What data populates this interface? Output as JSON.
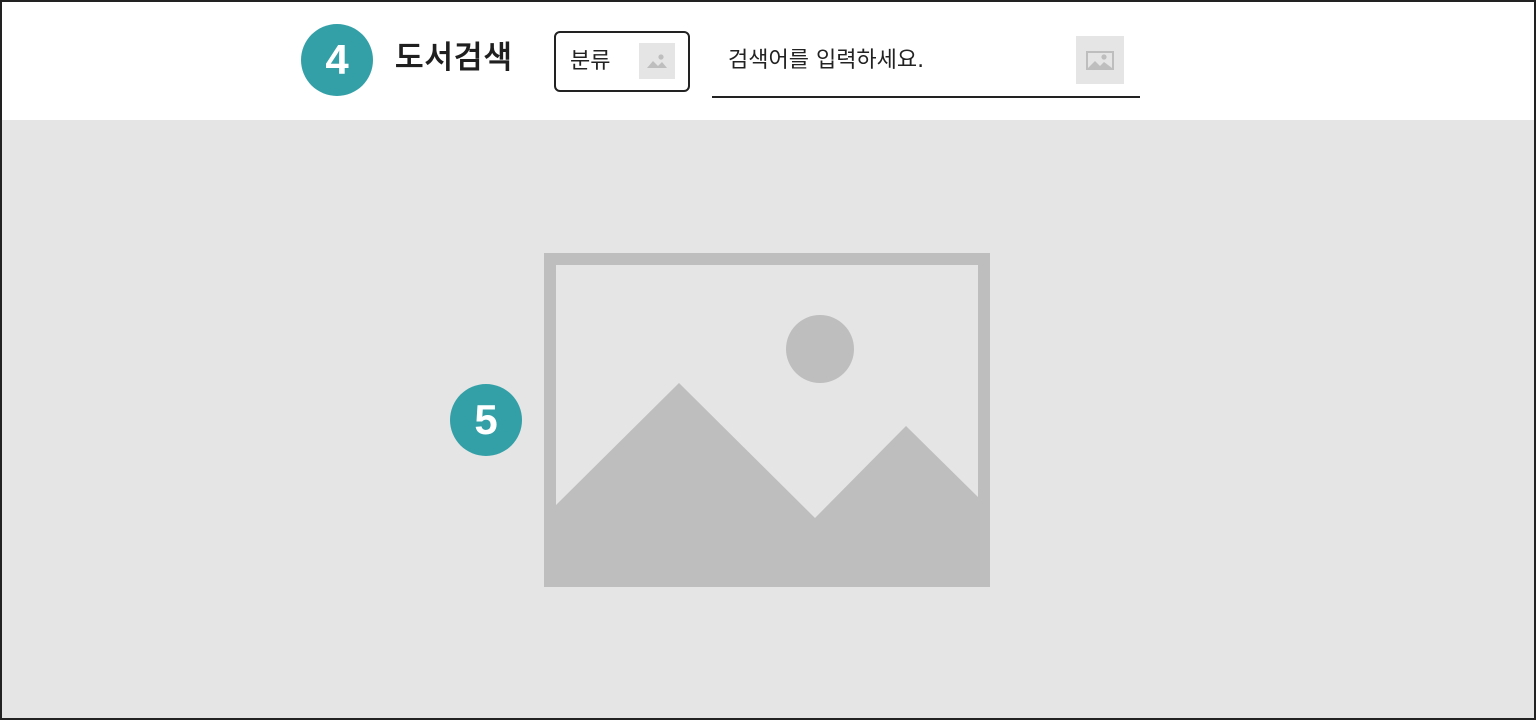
{
  "colors": {
    "accent": "#33a0a8",
    "placeholder_bg": "#e5e5e5",
    "placeholder_fg": "#bebebe",
    "border": "#222222"
  },
  "steps": {
    "search": "4",
    "content": "5"
  },
  "search_section": {
    "title": "도서검색",
    "category": {
      "label": "분류",
      "icon": "image-placeholder-icon"
    },
    "search": {
      "placeholder": "검색어를 입력하세요.",
      "value": "",
      "button_icon": "image-placeholder-icon"
    }
  },
  "main": {
    "image_icon": "image-placeholder-icon"
  }
}
